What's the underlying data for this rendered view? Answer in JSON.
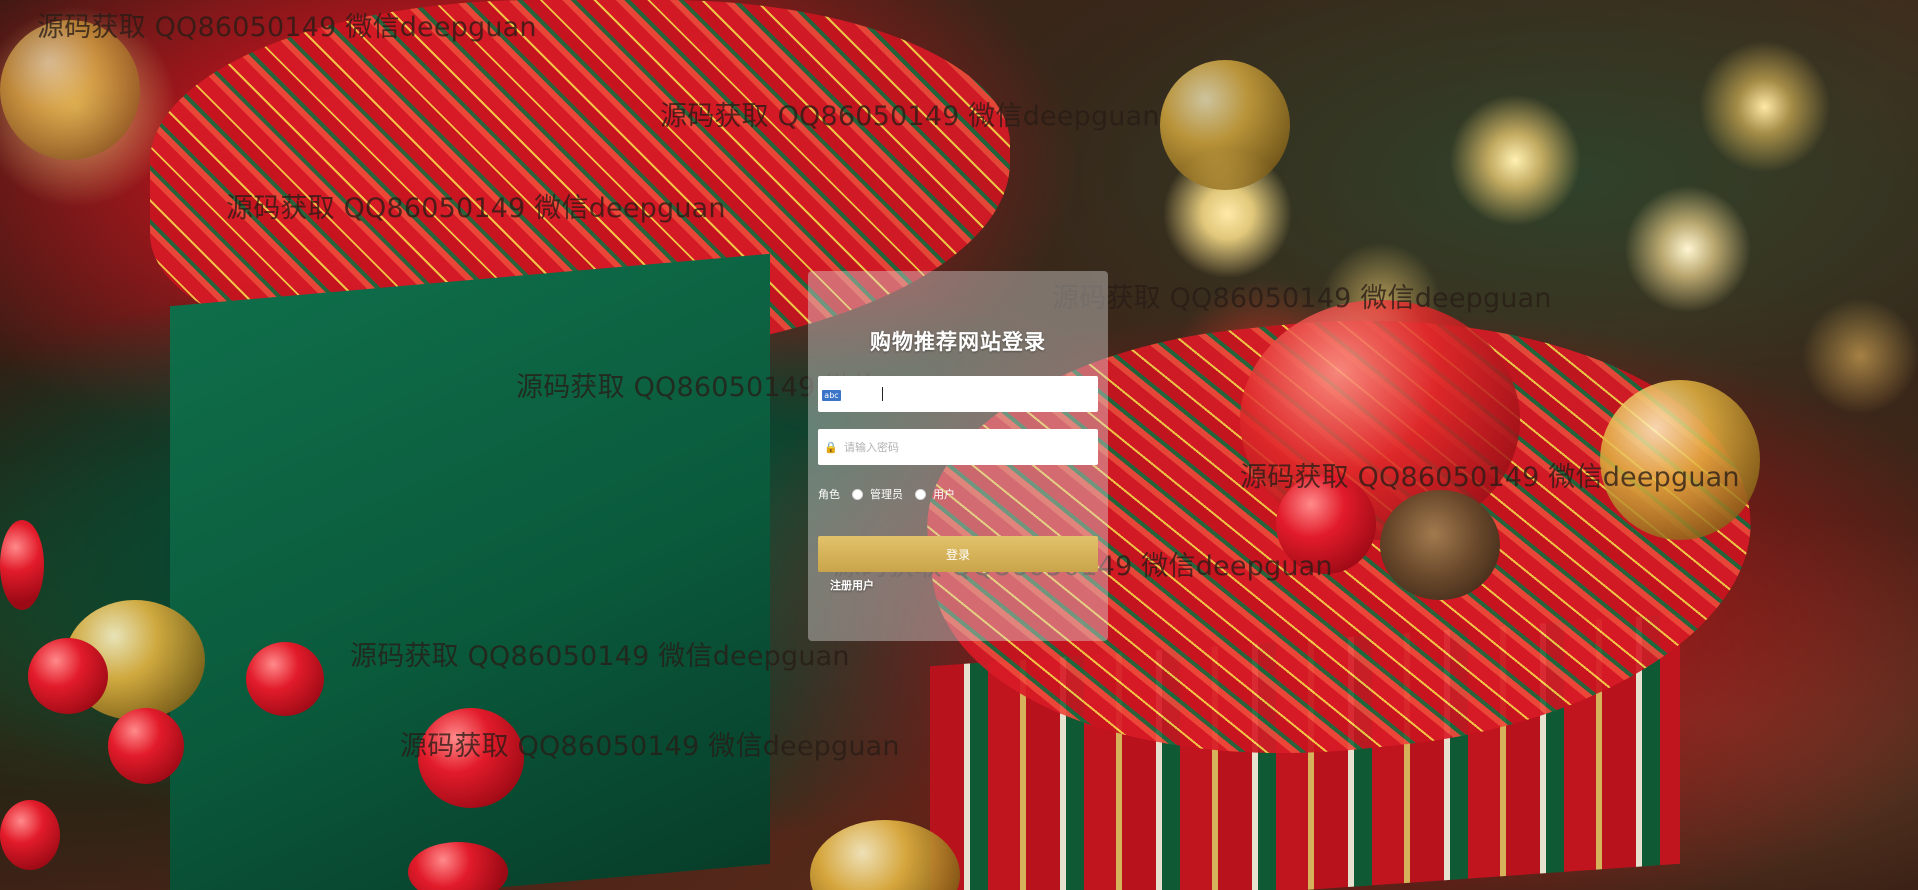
{
  "login": {
    "title": "购物推荐网站登录",
    "username_value": "",
    "username_badge": "abc",
    "password_placeholder": "请输入密码",
    "role_label": "角色",
    "role_options": [
      "管理员",
      "用户"
    ],
    "submit_label": "登录",
    "register_label": "注册用户"
  },
  "watermark_text": "源码获取 QQ86050149 微信deepguan",
  "colors": {
    "panel_bg": "rgba(220,220,220,0.42)",
    "button": "#d4b056",
    "title": "#ffffff"
  }
}
